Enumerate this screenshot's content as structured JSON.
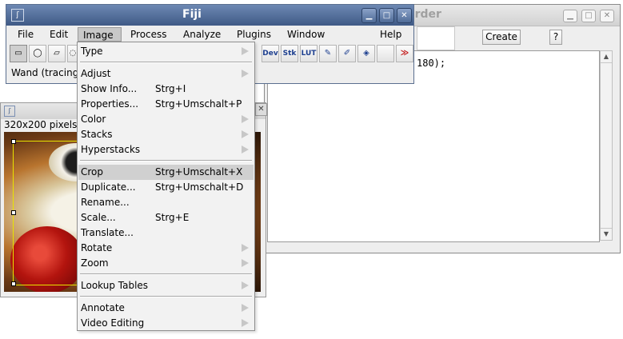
{
  "recorder": {
    "title": "order",
    "create_label": "Create",
    "help_label": "?",
    "code_text": "180);"
  },
  "image_window": {
    "info": "320x200 pixels"
  },
  "fiji": {
    "title": "Fiji",
    "menus": [
      "File",
      "Edit",
      "Image",
      "Process",
      "Analyze",
      "Plugins",
      "Window",
      "Help"
    ],
    "active_menu": "Image",
    "tools_right": [
      "Dev",
      "Stk",
      "LUT"
    ],
    "more_tools": "≫",
    "status": "Wand (tracing)"
  },
  "image_menu": {
    "items": [
      {
        "label": "Type",
        "shortcut": ""
      },
      {
        "label": "Adjust",
        "shortcut": ""
      },
      {
        "label": "Show Info...",
        "shortcut": "Strg+I"
      },
      {
        "label": "Properties...",
        "shortcut": "Strg+Umschalt+P"
      },
      {
        "label": "Color",
        "shortcut": ""
      },
      {
        "label": "Stacks",
        "shortcut": ""
      },
      {
        "label": "Hyperstacks",
        "shortcut": ""
      },
      {
        "label": "Crop",
        "shortcut": "Strg+Umschalt+X"
      },
      {
        "label": "Duplicate...",
        "shortcut": "Strg+Umschalt+D"
      },
      {
        "label": "Rename...",
        "shortcut": ""
      },
      {
        "label": "Scale...",
        "shortcut": "Strg+E"
      },
      {
        "label": "Translate...",
        "shortcut": ""
      },
      {
        "label": "Rotate",
        "shortcut": ""
      },
      {
        "label": "Zoom",
        "shortcut": ""
      },
      {
        "label": "Lookup Tables",
        "shortcut": ""
      },
      {
        "label": "Annotate",
        "shortcut": ""
      },
      {
        "label": "Video Editing",
        "shortcut": ""
      }
    ],
    "highlighted": "Crop"
  }
}
